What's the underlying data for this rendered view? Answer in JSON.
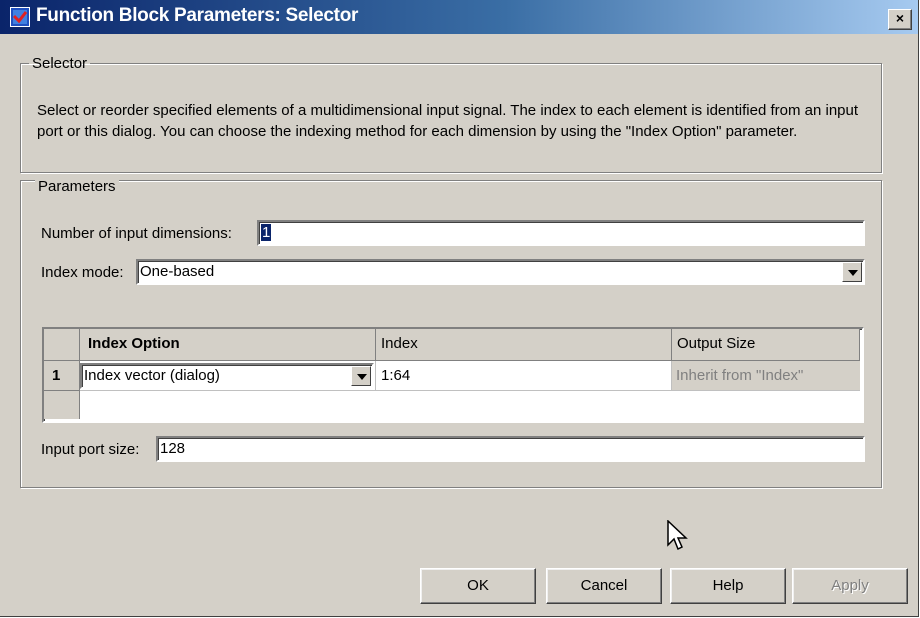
{
  "window": {
    "title": "Function Block Parameters: Selector",
    "close_glyph": "×"
  },
  "selector_group": {
    "legend": "Selector",
    "description": "Select or reorder specified elements of a multidimensional input signal. The index to each element is identified from an input port or this dialog. You can choose the indexing method for each dimension by using the \"Index Option\" parameter."
  },
  "parameters_group": {
    "legend": "Parameters",
    "num_dims_label": "Number of input dimensions:",
    "num_dims_value": "1",
    "index_mode_label": "Index mode:",
    "index_mode_value": "One-based",
    "table": {
      "headers": [
        "Index Option",
        "Index",
        "Output Size"
      ],
      "rows": [
        {
          "row_num": "1",
          "index_option": "Index vector (dialog)",
          "index": "1:64",
          "output_size": "Inherit from \"Index\""
        }
      ]
    },
    "input_port_size_label": "Input port size:",
    "input_port_size_value": "128"
  },
  "buttons": {
    "ok": "OK",
    "cancel": "Cancel",
    "help": "Help",
    "apply": "Apply"
  },
  "icons": {
    "app": "simulink-block-icon",
    "close": "close-icon",
    "dropdown": "chevron-down-icon",
    "cursor": "mouse-pointer-icon"
  }
}
